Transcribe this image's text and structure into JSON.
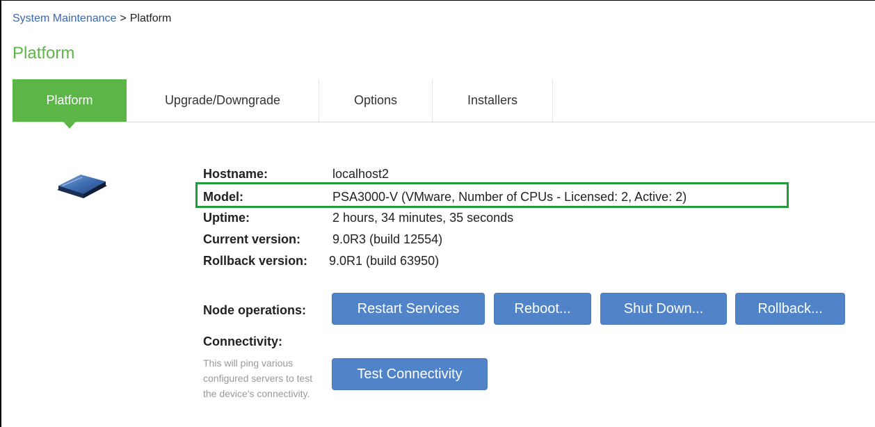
{
  "breadcrumb": {
    "parent": "System Maintenance",
    "separator": ">",
    "current": "Platform"
  },
  "page_title": "Platform",
  "tabs": [
    {
      "label": "Platform",
      "active": true
    },
    {
      "label": "Upgrade/Downgrade",
      "active": false
    },
    {
      "label": "Options",
      "active": false
    },
    {
      "label": "Installers",
      "active": false
    }
  ],
  "info": {
    "hostname_label": "Hostname:",
    "hostname_value": "localhost2",
    "model_label": "Model:",
    "model_value": "PSA3000-V (VMware, Number of CPUs - Licensed: 2, Active: 2)",
    "uptime_label": "Uptime:",
    "uptime_value": "2 hours, 34 minutes, 35 seconds",
    "current_version_label": "Current version:",
    "current_version_value": "9.0R3 (build 12554)",
    "rollback_version_label": "Rollback version:",
    "rollback_version_value": "9.0R1 (build 63950)"
  },
  "node_operations": {
    "label": "Node operations:",
    "buttons": {
      "restart": "Restart Services",
      "reboot": "Reboot...",
      "shutdown": "Shut Down...",
      "rollback": "Rollback..."
    }
  },
  "connectivity": {
    "label": "Connectivity:",
    "help_text": "This will ping various configured servers to test the device's connectivity.",
    "button": "Test Connectivity"
  },
  "colors": {
    "accent_green": "#5cb547",
    "button_blue": "#5083c8",
    "highlight_border": "#1f9b3a",
    "link_blue": "#3a68b0"
  },
  "icons": {
    "device": "appliance-icon"
  }
}
